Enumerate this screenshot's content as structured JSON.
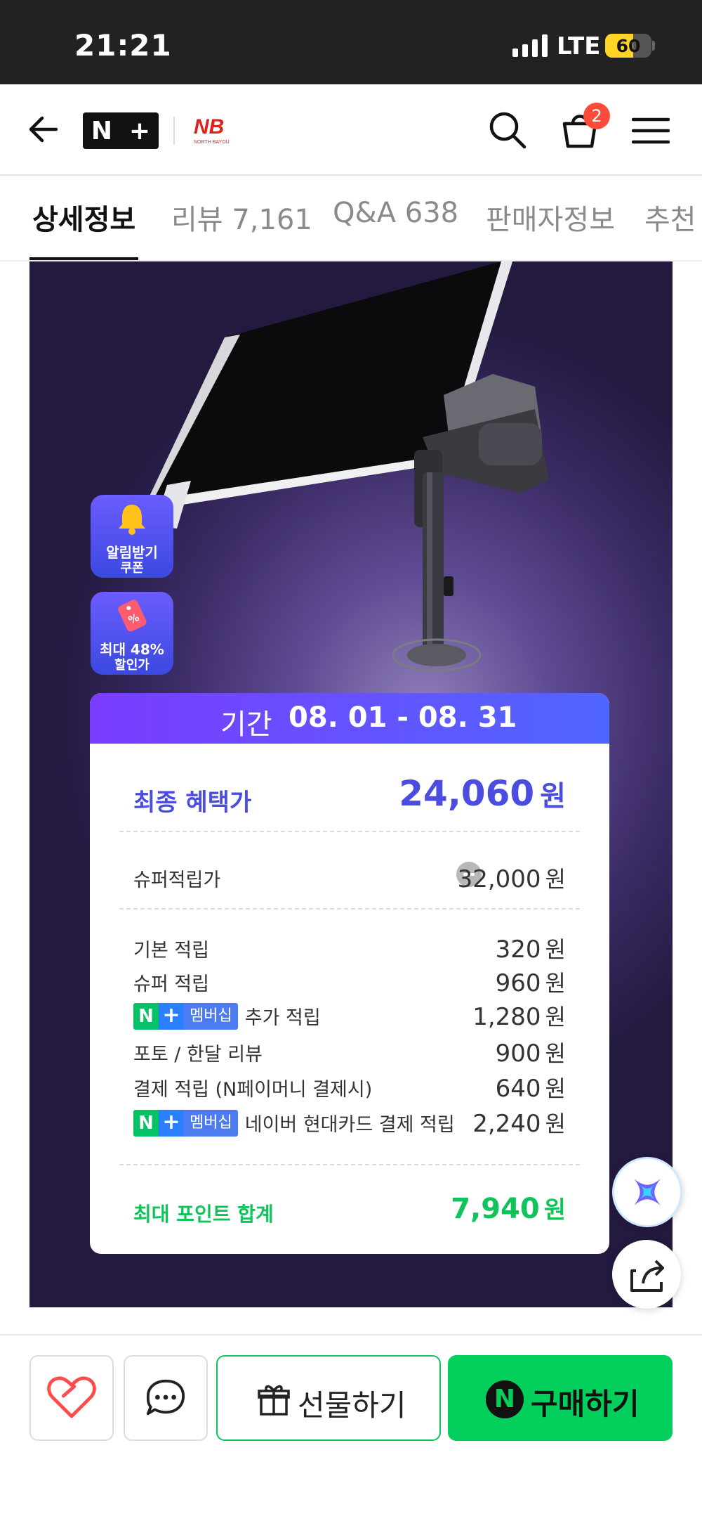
{
  "status_bar": {
    "time": "21:21",
    "network": "LTE",
    "battery": "60",
    "battery_level": 0.6
  },
  "header": {
    "back_icon": "back-arrow-icon",
    "platform_logo": "N+",
    "brand_logo_text": "NB",
    "brand_logo_subtext": "NORTH BAYOU",
    "cart_count": "2"
  },
  "tabs": [
    {
      "label": "상세정보",
      "active": true
    },
    {
      "label": "리뷰 7,161",
      "active": false
    },
    {
      "label": "Q&A 638",
      "active": false
    },
    {
      "label": "판매자정보",
      "active": false
    },
    {
      "label": "추천",
      "active": false
    }
  ],
  "banner": {
    "alarm_badge": {
      "line1": "알림받기",
      "line2": "쿠폰"
    },
    "discount_badge": {
      "line1": "최대 48%",
      "line2": "할인가"
    },
    "period_label": "기간",
    "period_value": "08. 01 - 08. 31",
    "final_price_label": "최종 혜택가",
    "final_price_value": "24,060",
    "currency": "원",
    "super_points_label": "슈퍼적립가",
    "super_points_value": "32,000",
    "points_rows": [
      {
        "label": "기본 적립",
        "value": "320",
        "membership": false
      },
      {
        "label": "슈퍼 적립",
        "value": "960",
        "membership": false
      },
      {
        "label": "추가 적립",
        "value": "1,280",
        "membership": true
      },
      {
        "label": "포토 / 한달 리뷰",
        "value": "900",
        "membership": false
      },
      {
        "label": "결제 적립 (N페이머니 결제시)",
        "value": "640",
        "membership": false
      },
      {
        "label": "네이버 현대카드 결제 적립",
        "value": "2,240",
        "membership": true
      }
    ],
    "membership_badge": {
      "n": "N",
      "plus": "+",
      "text": "멤버십"
    },
    "total_label": "최대 포인트 합계",
    "total_value": "7,940"
  },
  "bottom_bar": {
    "gift_label": "선물하기",
    "buy_label": "구매하기",
    "buy_icon_letter": "N"
  },
  "colors": {
    "accent_purple": "#4b4de0",
    "accent_green": "#10c35a",
    "buy_green": "#03cf5d"
  }
}
